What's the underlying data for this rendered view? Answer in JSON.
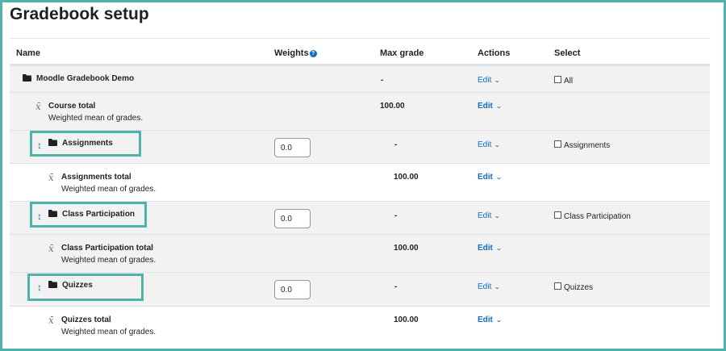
{
  "page": {
    "title": "Gradebook setup"
  },
  "columns": {
    "name": "Name",
    "weights": "Weights",
    "max_grade": "Max grade",
    "actions": "Actions",
    "select": "Select"
  },
  "rows": [
    {
      "kind": "category-root",
      "name": "Moodle Gradebook Demo",
      "max_grade": "-",
      "action": "Edit",
      "select": "All"
    },
    {
      "kind": "total",
      "name": "Course total",
      "desc": "Weighted mean of grades.",
      "max_grade": "100.00",
      "action": "Edit"
    },
    {
      "kind": "category",
      "name": "Assignments",
      "weight": "0.0",
      "max_grade": "-",
      "action": "Edit",
      "select": "Assignments"
    },
    {
      "kind": "total",
      "name": "Assignments total",
      "desc": "Weighted mean of grades.",
      "max_grade": "100.00",
      "action": "Edit"
    },
    {
      "kind": "category",
      "name": "Class Participation",
      "weight": "0.0",
      "max_grade": "-",
      "action": "Edit",
      "select": "Class Participation"
    },
    {
      "kind": "total",
      "name": "Class Participation total",
      "desc": "Weighted mean of grades.",
      "max_grade": "100.00",
      "action": "Edit"
    },
    {
      "kind": "category",
      "name": "Quizzes",
      "weight": "0.0",
      "max_grade": "-",
      "action": "Edit",
      "select": "Quizzes"
    },
    {
      "kind": "total",
      "name": "Quizzes total",
      "desc": "Weighted mean of grades.",
      "max_grade": "100.00",
      "action": "Edit"
    }
  ],
  "icons": {
    "help": "question-circle-icon",
    "folder": "folder-icon",
    "total": "x-bar-mean-icon",
    "move": "move-arrows-icon",
    "dropdown": "chevron-down-icon"
  },
  "colors": {
    "accent": "#0f6cbf",
    "highlight": "#4fb3a9",
    "row_grey": "#f2f2f2"
  }
}
